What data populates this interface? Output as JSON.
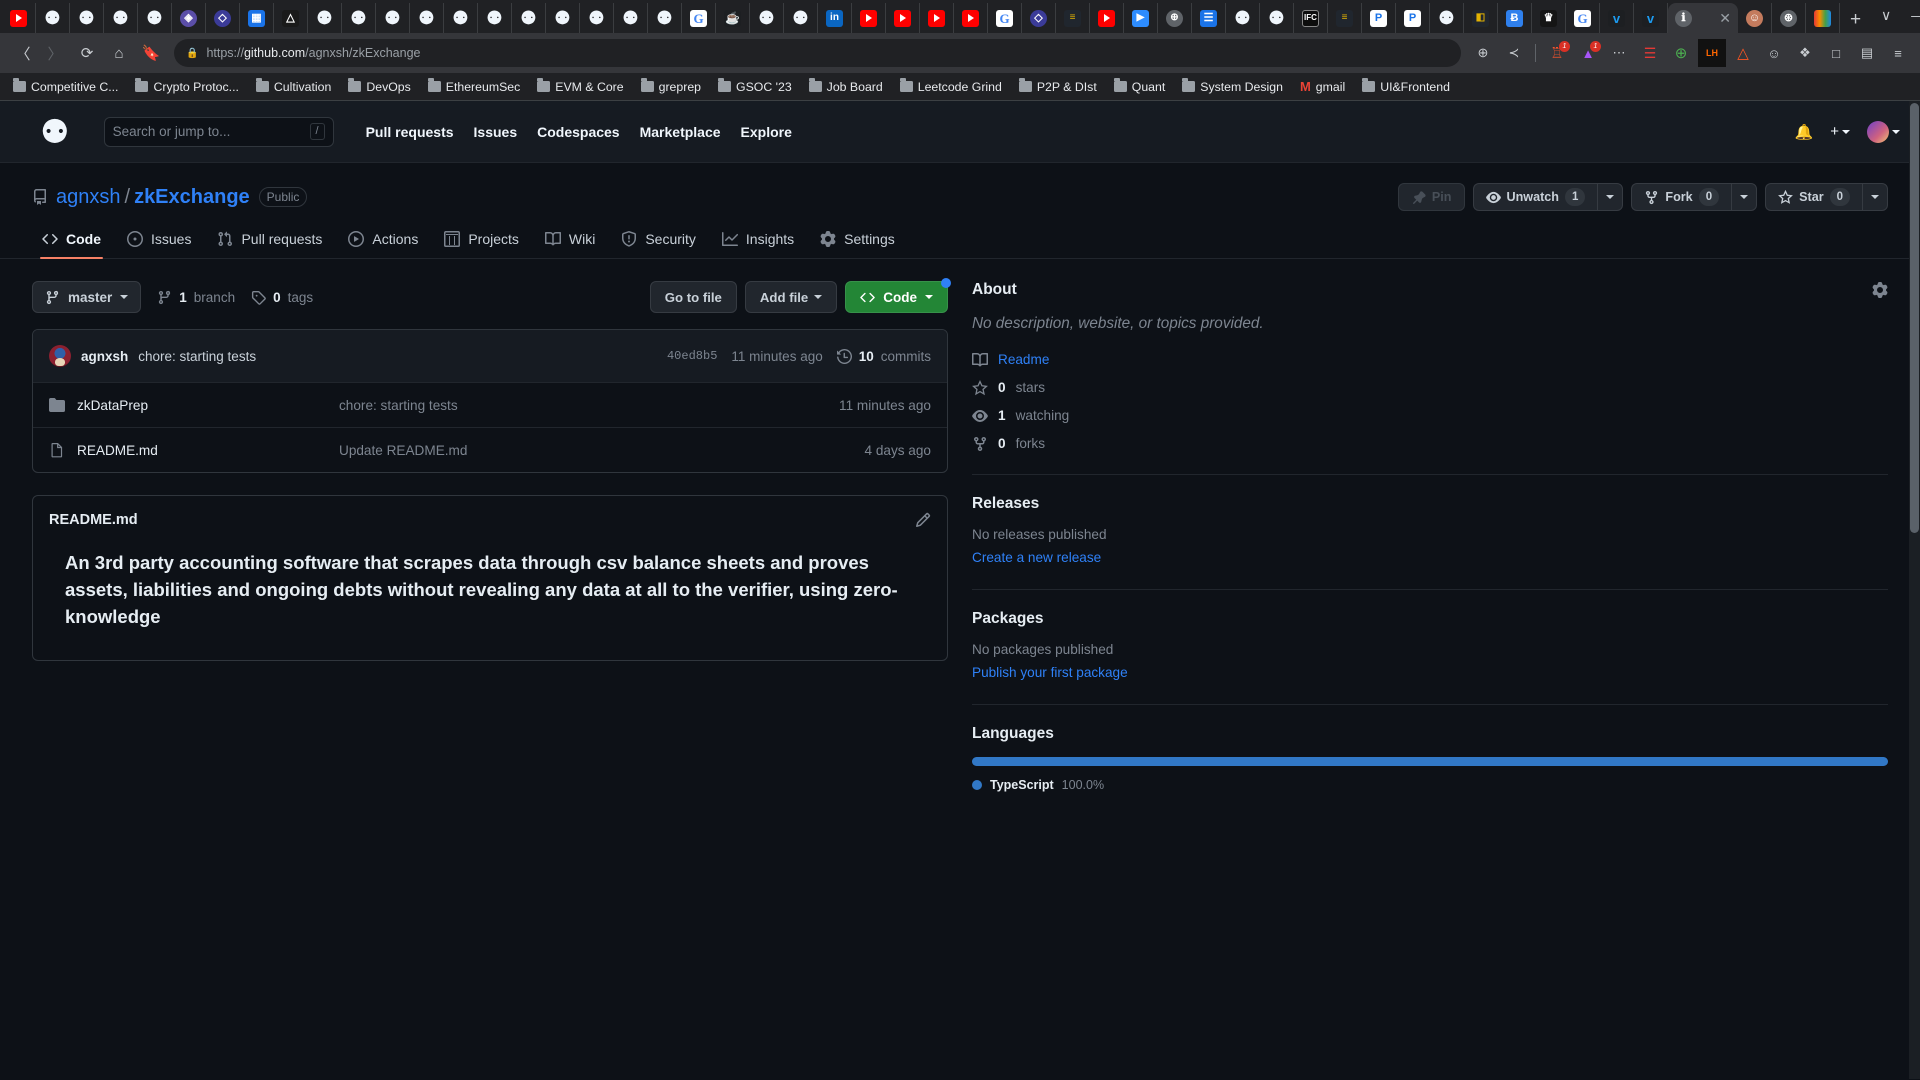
{
  "browser": {
    "tabs": [
      {
        "icon": "youtube-icon",
        "cls": "fav-yt",
        "glyph": ""
      },
      {
        "icon": "github-icon",
        "cls": "fav-gh",
        "glyph": "⚉"
      },
      {
        "icon": "github-icon",
        "cls": "fav-gh",
        "glyph": "⚉"
      },
      {
        "icon": "github-icon",
        "cls": "fav-gh",
        "glyph": "⚉"
      },
      {
        "icon": "github-icon",
        "cls": "fav-gh",
        "glyph": "⚉"
      },
      {
        "icon": "ethereum-icon",
        "cls": "fav-purple",
        "glyph": "◈"
      },
      {
        "icon": "circle-icon",
        "cls": "fav-indigo",
        "glyph": "◇"
      },
      {
        "icon": "dashboard-icon",
        "cls": "fav-blue",
        "glyph": "▦"
      },
      {
        "icon": "google-drive-icon",
        "cls": "fav-drive",
        "glyph": "△"
      },
      {
        "icon": "github-icon",
        "cls": "fav-gh",
        "glyph": "⚉"
      },
      {
        "icon": "github-icon",
        "cls": "fav-gh",
        "glyph": "⚉"
      },
      {
        "icon": "github-icon",
        "cls": "fav-gh",
        "glyph": "⚉"
      },
      {
        "icon": "github-icon",
        "cls": "fav-gh",
        "glyph": "⚉"
      },
      {
        "icon": "github-icon",
        "cls": "fav-gh",
        "glyph": "⚉"
      },
      {
        "icon": "github-icon",
        "cls": "fav-gh",
        "glyph": "⚉"
      },
      {
        "icon": "github-icon",
        "cls": "fav-gh",
        "glyph": "⚉"
      },
      {
        "icon": "github-icon",
        "cls": "fav-gh",
        "glyph": "⚉"
      },
      {
        "icon": "github-icon",
        "cls": "fav-gh",
        "glyph": "⚉"
      },
      {
        "icon": "github-icon",
        "cls": "fav-gh",
        "glyph": "⚉"
      },
      {
        "icon": "github-icon",
        "cls": "fav-gh",
        "glyph": "⚉"
      },
      {
        "icon": "google-icon",
        "cls": "fav-google",
        "glyph": "G"
      },
      {
        "icon": "java-icon",
        "cls": "fav-java",
        "glyph": "☕"
      },
      {
        "icon": "github-icon",
        "cls": "fav-gh",
        "glyph": "⚉"
      },
      {
        "icon": "github-icon",
        "cls": "fav-gh",
        "glyph": "⚉"
      },
      {
        "icon": "linkedin-icon",
        "cls": "fav-li",
        "glyph": "in"
      },
      {
        "icon": "youtube-icon",
        "cls": "fav-yt",
        "glyph": ""
      },
      {
        "icon": "youtube-icon",
        "cls": "fav-yt",
        "glyph": ""
      },
      {
        "icon": "youtube-icon",
        "cls": "fav-yt",
        "glyph": ""
      },
      {
        "icon": "youtube-icon",
        "cls": "fav-yt",
        "glyph": ""
      },
      {
        "icon": "google-icon",
        "cls": "fav-google",
        "glyph": "G"
      },
      {
        "icon": "ethereum-icon",
        "cls": "fav-indigo",
        "glyph": "◇"
      },
      {
        "icon": "zhihu-icon",
        "cls": "fav-wallet",
        "glyph": "≡"
      },
      {
        "icon": "youtube-icon",
        "cls": "fav-yt",
        "glyph": ""
      },
      {
        "icon": "zoom-icon",
        "cls": "fav-cam",
        "glyph": "▶"
      },
      {
        "icon": "globe-icon",
        "cls": "fav-globe",
        "glyph": "⊕"
      },
      {
        "icon": "docs-icon",
        "cls": "fav-list",
        "glyph": "☰"
      },
      {
        "icon": "github-icon",
        "cls": "fav-gh",
        "glyph": "⚉"
      },
      {
        "icon": "github-icon",
        "cls": "fav-gh",
        "glyph": "⚉"
      },
      {
        "icon": "ifc-icon",
        "cls": "fav-ifc",
        "glyph": "IFC"
      },
      {
        "icon": "zhihu-icon",
        "cls": "fav-wallet",
        "glyph": "≡"
      },
      {
        "icon": "paypal-icon",
        "cls": "fav-paypal",
        "glyph": "P"
      },
      {
        "icon": "paypal-icon",
        "cls": "fav-paypal",
        "glyph": "P"
      },
      {
        "icon": "github-icon",
        "cls": "fav-gh",
        "glyph": "⚉"
      },
      {
        "icon": "wallet-icon",
        "cls": "fav-wallet",
        "glyph": "◧"
      },
      {
        "icon": "bitcoin-icon",
        "cls": "fav-btc",
        "glyph": "Ƀ"
      },
      {
        "icon": "crown-icon",
        "cls": "fav-crown",
        "glyph": "♛"
      },
      {
        "icon": "google-icon",
        "cls": "fav-google",
        "glyph": "G"
      },
      {
        "icon": "twitter-icon",
        "cls": "fav-tw",
        "glyph": "ᴠ"
      },
      {
        "icon": "twitter-icon",
        "cls": "fav-tw",
        "glyph": "ᴠ"
      }
    ],
    "active_tab": {
      "icon": "info-icon",
      "glyph": "ℹ",
      "close": "✕"
    },
    "tabs_after": [
      {
        "icon": "avatar-icon",
        "cls": "fav-avatar",
        "glyph": "☺"
      },
      {
        "icon": "openai-icon",
        "cls": "fav-grey",
        "glyph": "⊛"
      },
      {
        "icon": "rainbow-icon",
        "cls": "fav-rainbow",
        "glyph": ""
      }
    ],
    "new_tab_glyph": "+",
    "window_controls": [
      "∨",
      "—",
      "❐",
      "✕"
    ],
    "nav": {
      "back": "◀",
      "forward": "▶",
      "reload": "↻",
      "home": "⌂",
      "bookmark": "☐"
    },
    "url": {
      "lock": "ὑ2",
      "prefix": "https://",
      "domain": "github.com",
      "path": "/agnxsh/zkExchange"
    },
    "address_icons": [
      {
        "name": "zoom-icon",
        "glyph": "⊕",
        "badge": ""
      },
      {
        "name": "share-icon",
        "glyph": "≺",
        "badge": ""
      },
      {
        "name": "brave-shields-icon",
        "glyph": "♖",
        "badge": "1"
      },
      {
        "name": "brave-rewards-icon",
        "glyph": "▲",
        "badge": "1"
      },
      {
        "name": "extension-dots-icon",
        "glyph": "⋯",
        "badge": ""
      },
      {
        "name": "todoist-icon",
        "glyph": "☰",
        "badge": ""
      },
      {
        "name": "add-extension-icon",
        "glyph": "⊕",
        "badge": ""
      },
      {
        "name": "lighthouse-icon",
        "glyph": "LH",
        "badge": ""
      },
      {
        "name": "avalanche-icon",
        "glyph": "△",
        "badge": ""
      },
      {
        "name": "metamask-icon",
        "glyph": "☺",
        "badge": ""
      },
      {
        "name": "puzzle-icon",
        "glyph": "❖",
        "badge": ""
      },
      {
        "name": "sidebar-icon",
        "glyph": "□",
        "badge": ""
      },
      {
        "name": "wallet-icon",
        "glyph": "▤",
        "badge": ""
      },
      {
        "name": "menu-icon",
        "glyph": "≡",
        "badge": ""
      }
    ],
    "bookmarks": [
      {
        "label": "Competitive C...",
        "type": "folder"
      },
      {
        "label": "Crypto Protoc...",
        "type": "folder"
      },
      {
        "label": "Cultivation",
        "type": "folder"
      },
      {
        "label": "DevOps",
        "type": "folder"
      },
      {
        "label": "EthereumSec",
        "type": "folder"
      },
      {
        "label": "EVM & Core",
        "type": "folder"
      },
      {
        "label": "greprep",
        "type": "folder"
      },
      {
        "label": "GSOC '23",
        "type": "folder"
      },
      {
        "label": "Job Board",
        "type": "folder"
      },
      {
        "label": "Leetcode Grind",
        "type": "folder"
      },
      {
        "label": "P2P & DIst",
        "type": "folder"
      },
      {
        "label": "Quant",
        "type": "folder"
      },
      {
        "label": "System Design",
        "type": "folder"
      },
      {
        "label": "gmail",
        "type": "gmail"
      },
      {
        "label": "UI&Frontend",
        "type": "folder"
      }
    ]
  },
  "github": {
    "header": {
      "logo": "github-logo",
      "search_placeholder": "Search or jump to...",
      "search_key": "/",
      "nav": [
        "Pull requests",
        "Issues",
        "Codespaces",
        "Marketplace",
        "Explore"
      ],
      "notifications_icon": "bell-icon",
      "plus_icon": "plus-icon",
      "avatar": "user-avatar"
    },
    "repo": {
      "owner": "agnxsh",
      "separator": "/",
      "name": "zkExchange",
      "visibility": "Public",
      "actions": {
        "pin": "Pin",
        "unwatch": "Unwatch",
        "watch_count": "1",
        "fork": "Fork",
        "fork_count": "0",
        "star": "Star",
        "star_count": "0"
      }
    },
    "tabs": [
      {
        "label": "Code",
        "icon": "code-icon",
        "selected": true
      },
      {
        "label": "Issues",
        "icon": "issue-opened-icon",
        "selected": false
      },
      {
        "label": "Pull requests",
        "icon": "git-pull-request-icon",
        "selected": false
      },
      {
        "label": "Actions",
        "icon": "play-icon",
        "selected": false
      },
      {
        "label": "Projects",
        "icon": "table-icon",
        "selected": false
      },
      {
        "label": "Wiki",
        "icon": "book-icon",
        "selected": false
      },
      {
        "label": "Security",
        "icon": "shield-icon",
        "selected": false
      },
      {
        "label": "Insights",
        "icon": "graph-icon",
        "selected": false
      },
      {
        "label": "Settings",
        "icon": "gear-icon",
        "selected": false
      }
    ],
    "branch_bar": {
      "branch": "master",
      "branches_count": "1",
      "branches_label": "branch",
      "tags_count": "0",
      "tags_label": "tags",
      "go_to_file": "Go to file",
      "add_file": "Add file",
      "code": "Code"
    },
    "latest_commit": {
      "author": "agnxsh",
      "message": "chore: starting tests",
      "sha": "40ed8b5",
      "time": "11 minutes ago",
      "commits_count": "10",
      "commits_label": "commits"
    },
    "files": [
      {
        "name": "zkDataPrep",
        "type": "folder",
        "message": "chore: starting tests",
        "time": "11 minutes ago"
      },
      {
        "name": "README.md",
        "type": "file",
        "message": "Update README.md",
        "time": "4 days ago"
      }
    ],
    "readme": {
      "title": "README.md",
      "edit_icon": "pencil-icon",
      "heading": "An 3rd party accounting software that scrapes data through csv balance sheets and proves assets, liabilities and ongoing debts without revealing any data at all to the verifier, using zero-knowledge"
    },
    "sidebar": {
      "about_title": "About",
      "gear_icon": "gear-icon",
      "no_description": "No description, website, or topics provided.",
      "items": [
        {
          "label": "Readme",
          "icon": "book-icon",
          "count": "",
          "link": true
        },
        {
          "label": "stars",
          "icon": "star-icon",
          "count": "0",
          "link": false
        },
        {
          "label": "watching",
          "icon": "eye-icon",
          "count": "1",
          "link": false
        },
        {
          "label": "forks",
          "icon": "fork-icon",
          "count": "0",
          "link": false
        }
      ],
      "releases_title": "Releases",
      "releases_note": "No releases published",
      "releases_link": "Create a new release",
      "packages_title": "Packages",
      "packages_note": "No packages published",
      "packages_link": "Publish your first package",
      "languages_title": "Languages",
      "languages": [
        {
          "name": "TypeScript",
          "percent": "100.0%",
          "color": "#3178c6"
        }
      ]
    }
  }
}
